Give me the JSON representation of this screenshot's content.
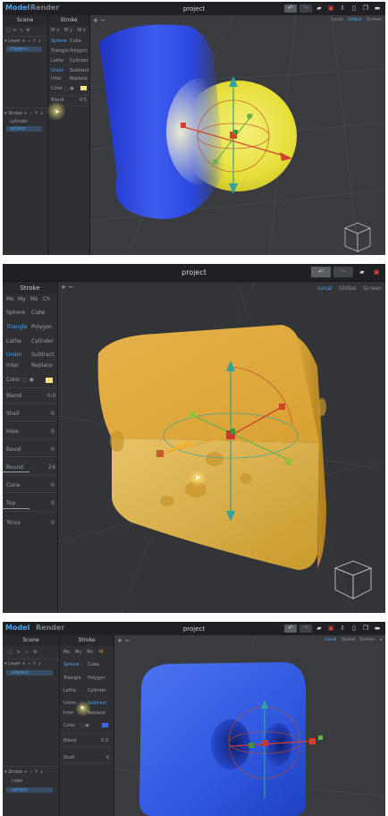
{
  "shot1": {
    "tabs": [
      "Model",
      "Render"
    ],
    "title": "project",
    "scene_title": "Scene",
    "stroke_title": "Stroke",
    "layer_header": "Layer",
    "layer_item": "<layer>",
    "stroke_header": "Stroke",
    "stroke_items": [
      "cylinder",
      "sphere"
    ],
    "primitive_rows": [
      [
        "Sphere",
        "Cube"
      ],
      [
        "Triangle",
        "Polygon"
      ],
      [
        "Lathe",
        "Cylinder"
      ],
      [
        "Union",
        "Subtract"
      ],
      [
        "Inter",
        "Replace"
      ]
    ],
    "color_label": "Color",
    "blend_label": "Blend",
    "blend_value": "0.5",
    "view_modes": [
      "Local",
      "Global",
      "Screen"
    ]
  },
  "shot2": {
    "title": "project",
    "stroke_title": "Stroke",
    "axis_buttons": [
      "Mx",
      "My",
      "Mz",
      "Ch"
    ],
    "primitive_rows": [
      [
        "Sphere",
        "Cube"
      ],
      [
        "Triangle",
        "Polygon"
      ],
      [
        "Lathe",
        "Cylinder"
      ],
      [
        "Union",
        "Subtract"
      ],
      [
        "Inter",
        "Replace"
      ]
    ],
    "color_label": "Color",
    "params": [
      {
        "label": "Blend",
        "value": "0.0"
      },
      {
        "label": "Shell",
        "value": "0"
      },
      {
        "label": "Hole",
        "value": "0"
      },
      {
        "label": "Bevel",
        "value": "0"
      },
      {
        "label": "Round",
        "value": "24"
      },
      {
        "label": "Cone",
        "value": "0"
      },
      {
        "label": "Top",
        "value": "0"
      },
      {
        "label": "Torus",
        "value": "0"
      }
    ],
    "view_modes": [
      "Local",
      "Global",
      "Screen"
    ]
  },
  "shot3": {
    "tabs": [
      "Model",
      "Render"
    ],
    "title": "project",
    "scene_title": "Scene",
    "stroke_title": "Stroke",
    "layer_header": "Layer",
    "layer_item": "<layer>",
    "axis_buttons": [
      "Mx",
      "My",
      "Mz",
      "M"
    ],
    "primitive_rows": [
      [
        "Sphere",
        "Cube"
      ],
      [
        "Triangle",
        "Polygon"
      ],
      [
        "Lathe",
        "Cylinder"
      ],
      [
        "Union",
        "Subtract"
      ],
      [
        "Inter",
        "Replace"
      ]
    ],
    "color_label": "Color",
    "blend_label": "Blend",
    "blend_value": "0.0",
    "shell_label": "Shell",
    "shell_value": "0",
    "stroke_header": "Stroke",
    "stroke_items": [
      "cube",
      "sphere"
    ],
    "view_modes": [
      "Local",
      "Global",
      "Screen"
    ]
  },
  "colors": {
    "accent": "#4aa3f0",
    "save_red": "#e0423b",
    "yellow_swatch": "#f4e38a",
    "blue_swatch": "#3c67e6"
  }
}
